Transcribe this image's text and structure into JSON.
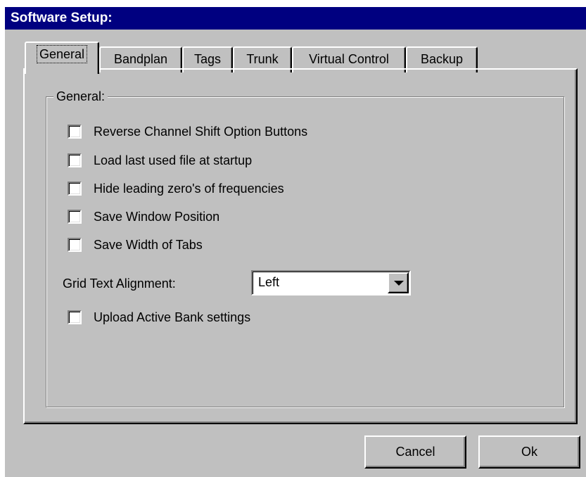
{
  "window": {
    "title": "Software Setup:"
  },
  "tabs": [
    {
      "label": "General",
      "active": true
    },
    {
      "label": "Bandplan",
      "active": false
    },
    {
      "label": "Tags",
      "active": false
    },
    {
      "label": "Trunk",
      "active": false
    },
    {
      "label": "Virtual Control",
      "active": false
    },
    {
      "label": "Backup",
      "active": false
    }
  ],
  "group": {
    "label": "General:"
  },
  "options": [
    {
      "label": "Reverse Channel Shift Option Buttons",
      "checked": false
    },
    {
      "label": "Load last used file at startup",
      "checked": false
    },
    {
      "label": "Hide leading zero's of frequencies",
      "checked": false
    },
    {
      "label": "Save Window Position",
      "checked": false
    },
    {
      "label": "Save Width of Tabs",
      "checked": false
    },
    {
      "label": "Upload Active Bank settings",
      "checked": false
    }
  ],
  "grid_alignment": {
    "label": "Grid Text Alignment:",
    "value": "Left"
  },
  "buttons": {
    "cancel": "Cancel",
    "ok": "Ok"
  },
  "colors": {
    "titlebar": "#000080",
    "face": "#c0c0c0"
  }
}
